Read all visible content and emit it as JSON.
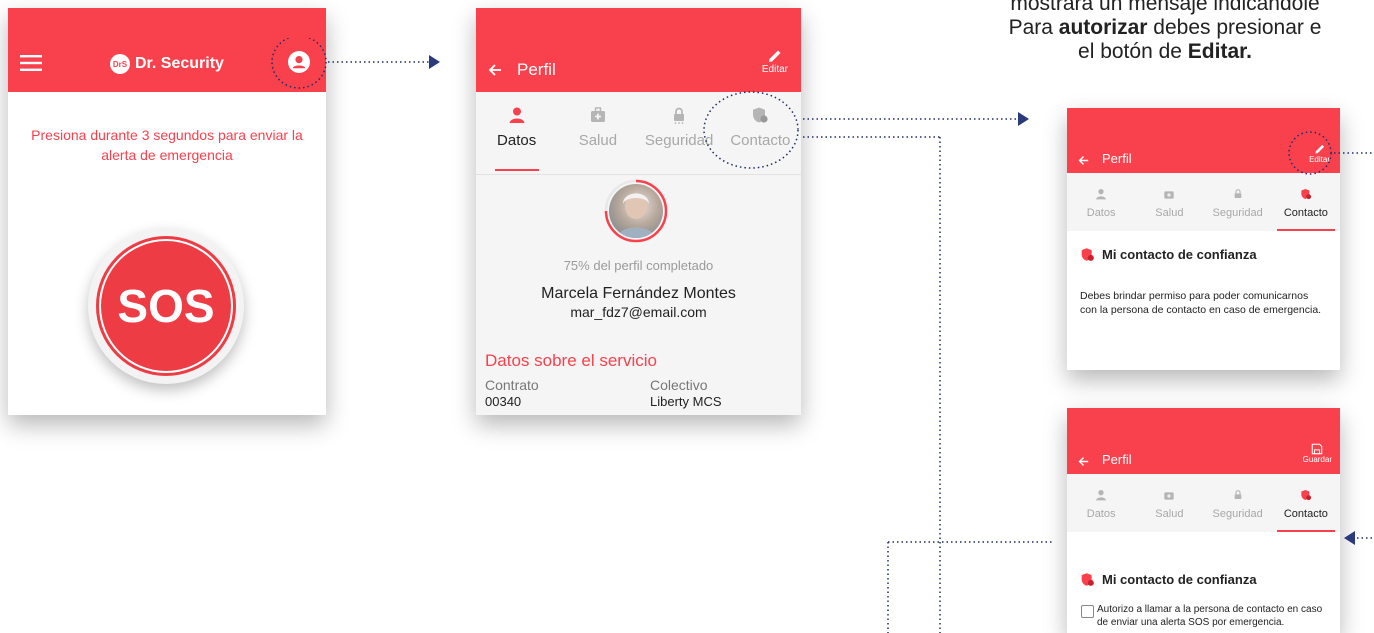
{
  "caption": {
    "line1": "mostrará un mensaje indicándole",
    "line2_pre": "Para ",
    "line2_bold": "autorizar",
    "line2_post": " debes presionar e",
    "line3_pre": "el botón de ",
    "line3_bold": "Editar."
  },
  "screen1": {
    "brand_logo": "DrS",
    "brand_name": "Dr. Security",
    "instruction": "Presiona durante 3 segundos para enviar la alerta de emergencia",
    "sos_label": "SOS"
  },
  "profile": {
    "back_title": "Perfil",
    "edit_label": "Editar",
    "save_label": "Guardar",
    "tabs": [
      {
        "label": "Datos"
      },
      {
        "label": "Salud"
      },
      {
        "label": "Seguridad"
      },
      {
        "label": "Contacto"
      }
    ],
    "progress_text": "75% del perfil completado",
    "progress_value": 0.75,
    "user_name": "Marcela Fernández Montes",
    "user_email": "mar_fdz7@email.com",
    "service_heading": "Datos sobre el servicio",
    "contract_label": "Contrato",
    "contract_value": "00340",
    "collective_label": "Colectivo",
    "collective_value": "Liberty MCS"
  },
  "contact": {
    "heading": "Mi contacto de confianza",
    "permission_text": "Debes brindar permiso para poder comunicarnos  con la persona de contacto en caso de emergencia.",
    "authorize_text": "Autorizo a llamar a la persona de contacto en caso de enviar una alerta SOS por emergencia.",
    "authorize_checked": false
  },
  "colors": {
    "brand_red": "#f9414d",
    "arrow_navy": "#2b3a7a"
  }
}
